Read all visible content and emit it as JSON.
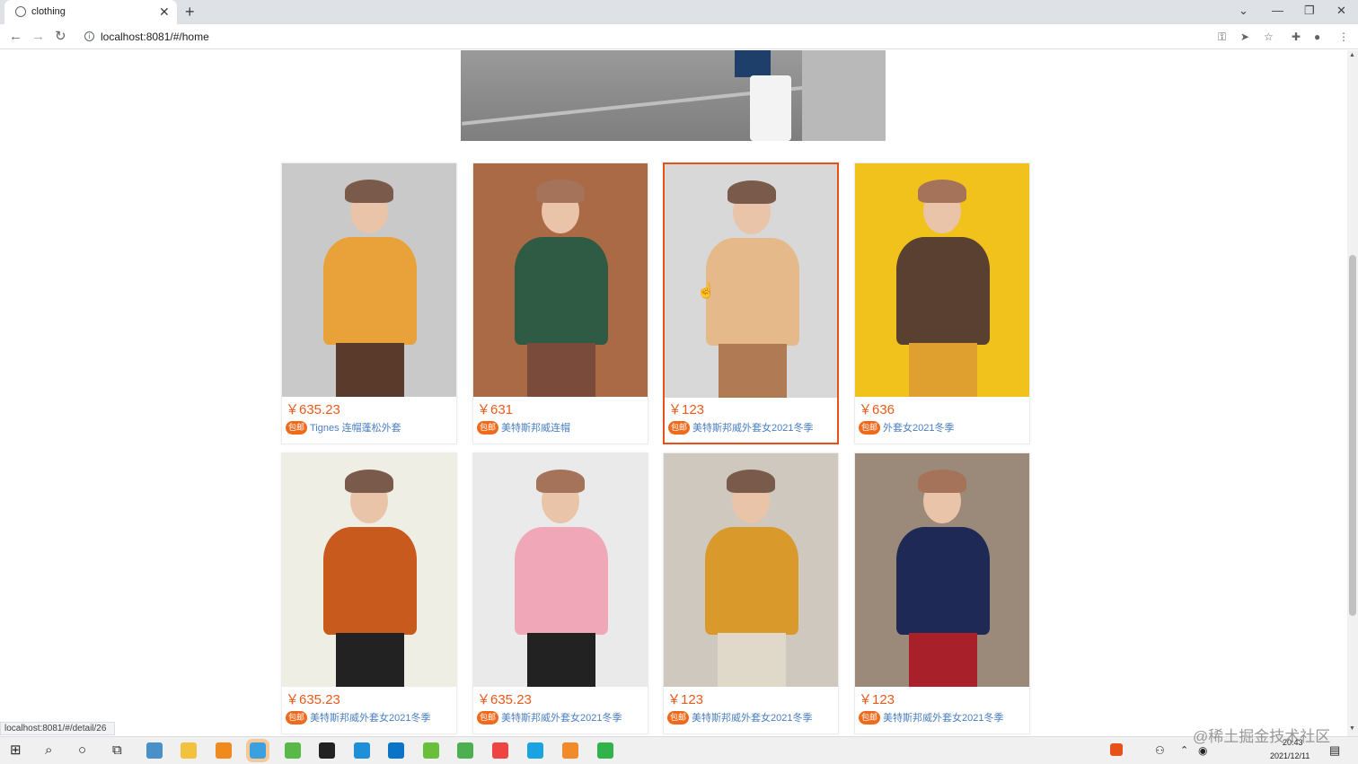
{
  "browser": {
    "tab_title": "clothing",
    "url": "localhost:8081/#/home",
    "status_url": "localhost:8081/#/detail/26"
  },
  "products": [
    {
      "price": "￥635.23",
      "badge": "包邮",
      "desc": "Tignes 连帽蓬松外套",
      "img_colors": [
        "#c9c9c9",
        "#e9a23a",
        "#5a3a2a"
      ]
    },
    {
      "price": "￥631",
      "badge": "包邮",
      "desc": "美特斯邦威连帽",
      "img_colors": [
        "#a96a45",
        "#2f5a44",
        "#7a4a3a"
      ]
    },
    {
      "price": "￥123",
      "badge": "包邮",
      "desc": "美特斯邦威外套女2021冬季",
      "img_colors": [
        "#d8d8d8",
        "#e6b98a",
        "#b07a55"
      ]
    },
    {
      "price": "￥636",
      "badge": "包邮",
      "desc": "外套女2021冬季",
      "img_colors": [
        "#f2c21c",
        "#5a4030",
        "#e0a030"
      ]
    },
    {
      "price": "￥635.23",
      "badge": "包邮",
      "desc": "美特斯邦威外套女2021冬季",
      "img_colors": [
        "#eeeee5",
        "#c85a1e",
        "#222222"
      ]
    },
    {
      "price": "￥635.23",
      "badge": "包邮",
      "desc": "美特斯邦威外套女2021冬季",
      "img_colors": [
        "#eaeaea",
        "#f0a8b8",
        "#222222"
      ]
    },
    {
      "price": "￥123",
      "badge": "包邮",
      "desc": "美特斯邦威外套女2021冬季",
      "img_colors": [
        "#cfc8bf",
        "#d99a2b",
        "#e0d8c8"
      ]
    },
    {
      "price": "￥123",
      "badge": "包邮",
      "desc": "美特斯邦威外套女2021冬季",
      "img_colors": [
        "#9b8a7a",
        "#1e2a55",
        "#a8202a"
      ]
    }
  ],
  "taskbar": {
    "time": "20:43",
    "date": "2021/12/11"
  },
  "watermark": "@稀土掘金技术社区",
  "colors": {
    "price": "#ea5a1c",
    "badge": "#f06a1c",
    "desc": "#4a7fc1",
    "selected_border": "#e8501a"
  }
}
